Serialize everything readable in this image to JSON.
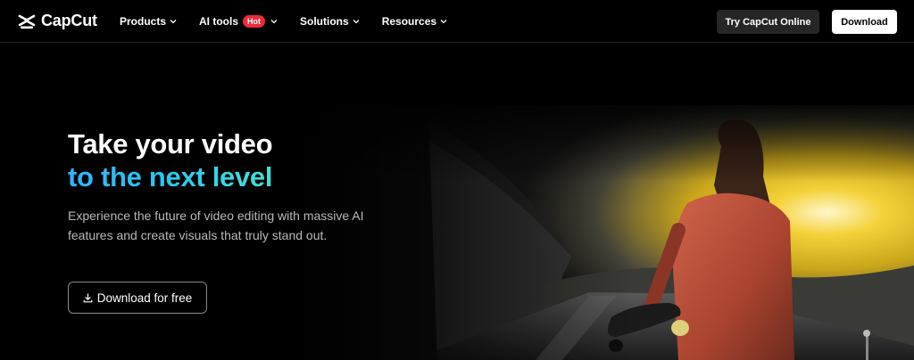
{
  "brand": {
    "name": "CapCut"
  },
  "nav": {
    "items": [
      {
        "label": "Products"
      },
      {
        "label": "AI tools",
        "badge": "Hot"
      },
      {
        "label": "Solutions"
      },
      {
        "label": "Resources"
      }
    ],
    "try_online_label": "Try CapCut Online",
    "download_label": "Download"
  },
  "hero": {
    "title_line1": "Take your video",
    "title_line2": "to the next level",
    "description": "Experience the future of video editing with massive AI features and create visuals that truly stand out.",
    "cta_label": "Download for free"
  },
  "icons": {
    "logo": "capcut-logo-icon",
    "chevron": "chevron-down-icon",
    "download": "download-icon"
  },
  "colors": {
    "background": "#000000",
    "accent_gradient_start": "#2fb3ff",
    "accent_gradient_end": "#3fe2d6",
    "hot_badge": "#ee2a3a",
    "secondary_button": "#262626",
    "primary_button": "#ffffff"
  }
}
